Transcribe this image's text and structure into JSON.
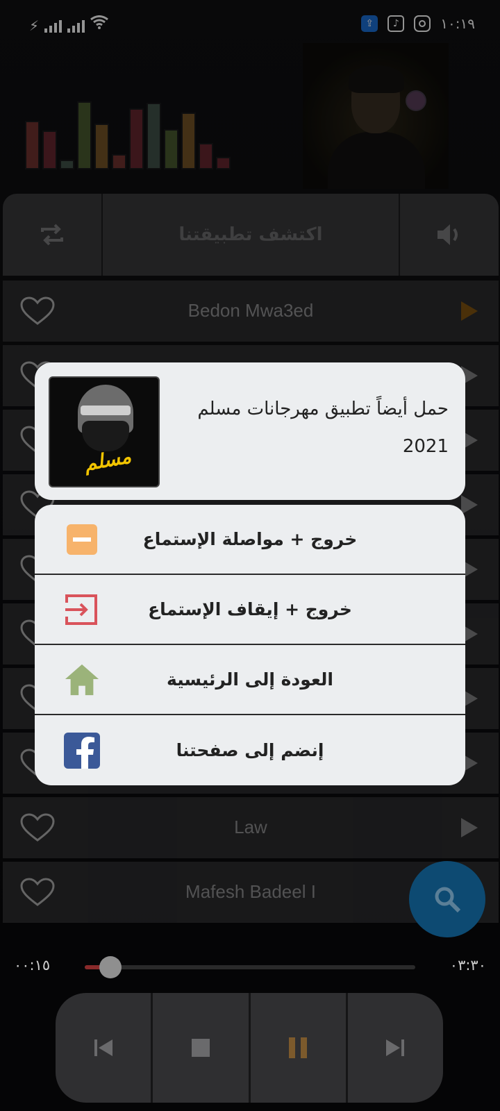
{
  "status_bar": {
    "time": "١٠:١٩",
    "icons": [
      "charging-bolt-icon",
      "signal-icon",
      "signal-icon",
      "wifi-icon",
      "usb-icon",
      "music-app-icon",
      "instagram-icon"
    ]
  },
  "header": {
    "banner_text": "اكتشف تطبيقتنا",
    "repeat_icon": "repeat-icon",
    "volume_icon": "volume-icon"
  },
  "songs": [
    {
      "title": "Bedon Mwa3ed",
      "active": true
    },
    {
      "title": "",
      "active": false
    },
    {
      "title": "",
      "active": false
    },
    {
      "title": "",
      "active": false
    },
    {
      "title": "",
      "active": false
    },
    {
      "title": "",
      "active": false
    },
    {
      "title": "",
      "active": false
    },
    {
      "title": "",
      "active": false
    },
    {
      "title": "Law",
      "active": false
    },
    {
      "title": "Mafesh Badeel I",
      "active": false
    }
  ],
  "dialog": {
    "promo_text": "حمل أيضاً تطبيق مهرجانات مسلم 2021",
    "promo_logo_text": "مسلم",
    "menu": [
      {
        "label": "خروج + مواصلة الإستماع",
        "icon": "minimize-icon",
        "color": "#f7b36b"
      },
      {
        "label": "خروج + إيقاف الإستماع",
        "icon": "exit-icon",
        "color": "#d9535b"
      },
      {
        "label": "العودة إلى الرئيسية",
        "icon": "home-icon",
        "color": "#9bb37a"
      },
      {
        "label": "إنضم إلى صفحتنا",
        "icon": "facebook-icon",
        "color": "#3b5998"
      }
    ]
  },
  "player": {
    "elapsed": "٠٠:١٥",
    "duration": "٠٣:٣٠",
    "progress": 0.077
  },
  "fab": {
    "icon": "search-icon",
    "color": "#0d4a72"
  }
}
